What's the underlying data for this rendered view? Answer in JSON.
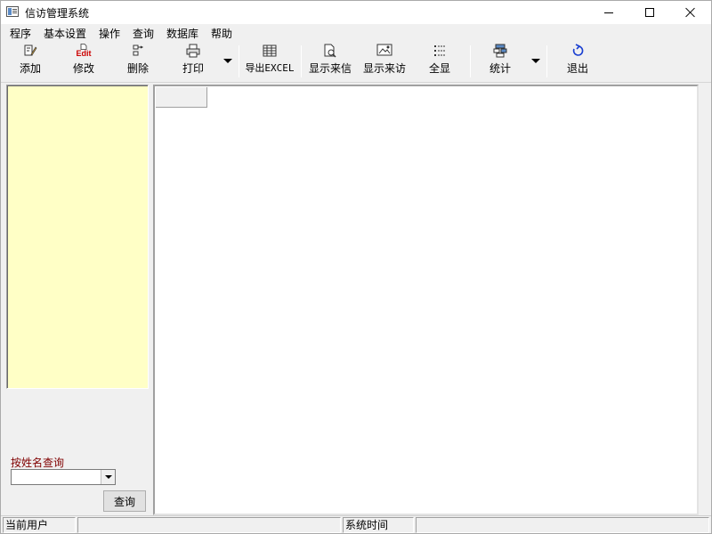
{
  "window": {
    "title": "信访管理系统",
    "icon": "app-window-icon"
  },
  "menubar": {
    "items": [
      "程序",
      "基本设置",
      "操作",
      "查询",
      "数据库",
      "帮助"
    ]
  },
  "toolbar": {
    "add": {
      "label": "添加",
      "icon": "add-pencil-icon"
    },
    "edit": {
      "label": "修改",
      "icon_text": "Edit"
    },
    "delete": {
      "label": "删除",
      "icon": "delete-icon"
    },
    "print": {
      "label": "打印",
      "icon": "printer-icon"
    },
    "export": {
      "label": "导出EXCEL",
      "icon": "spreadsheet-icon"
    },
    "show_letters": {
      "label": "显示来信",
      "icon": "letter-search-icon"
    },
    "show_visits": {
      "label": "显示来访",
      "icon": "visit-image-icon"
    },
    "show_all": {
      "label": "全显",
      "icon": "list-icon"
    },
    "stats": {
      "label": "统计",
      "icon": "stats-icon"
    },
    "exit": {
      "label": "退出",
      "icon": "exit-arrow-icon"
    }
  },
  "left_panel": {
    "search_label": "按姓名查询",
    "search_value": "",
    "search_button": "查询"
  },
  "statusbar": {
    "current_user_label": "当前用户",
    "current_user_value": "",
    "time_label": "系统时间",
    "time_value": ""
  },
  "colors": {
    "tree_background": "#ffffc6",
    "search_label": "#800000",
    "edit_icon": "#cc0000"
  }
}
